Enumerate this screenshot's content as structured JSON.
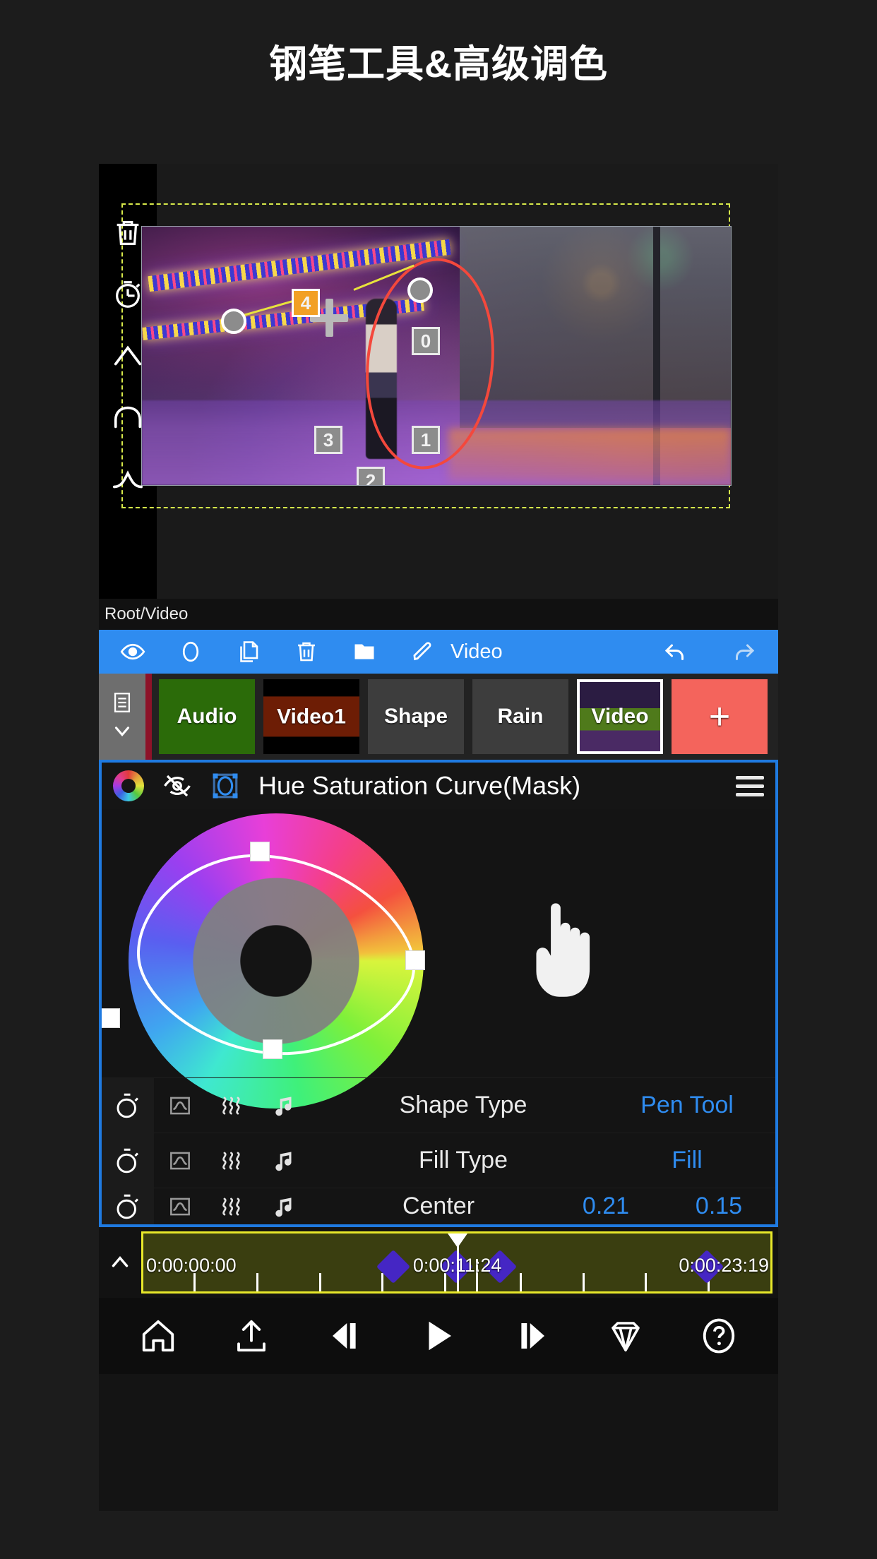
{
  "page": {
    "title": "钢笔工具&高级调色"
  },
  "preview": {
    "path_label": "Root/Video",
    "left_tools": [
      {
        "name": "delete-tool",
        "icon": "trash-icon"
      },
      {
        "name": "timer-tool",
        "icon": "stopwatch-icon"
      },
      {
        "name": "corner-point-tool",
        "icon": "corner-point-icon"
      },
      {
        "name": "smooth-point-tool",
        "icon": "smooth-curve-icon"
      },
      {
        "name": "bezier-point-tool",
        "icon": "bezier-anchor-icon"
      }
    ],
    "anchors": [
      {
        "label": "0"
      },
      {
        "label": "1"
      },
      {
        "label": "2"
      },
      {
        "label": "3"
      },
      {
        "label": "4",
        "selected": true
      }
    ]
  },
  "toolbar": {
    "items": [
      {
        "name": "visibility-button",
        "icon": "eye-icon"
      },
      {
        "name": "mask-button",
        "icon": "circle-outline-icon"
      },
      {
        "name": "duplicate-button",
        "icon": "copy-icon"
      },
      {
        "name": "delete-button",
        "icon": "trash-icon"
      },
      {
        "name": "folder-button",
        "icon": "folder-icon"
      },
      {
        "name": "rename-button",
        "icon": "pencil-icon"
      }
    ],
    "edit_label": "Video",
    "undo": {
      "name": "undo-button",
      "icon": "undo-icon"
    },
    "redo": {
      "name": "redo-button",
      "icon": "redo-icon"
    }
  },
  "layers": {
    "menu_icon": "list-icon",
    "expand_icon": "chevron-down-icon",
    "items": [
      {
        "label": "Audio",
        "type": "audio",
        "selected": false
      },
      {
        "label": "Video1",
        "type": "video",
        "selected": false
      },
      {
        "label": "Shape",
        "type": "shape",
        "selected": false
      },
      {
        "label": "Rain",
        "type": "effect",
        "selected": false
      },
      {
        "label": "Video",
        "type": "video",
        "selected": true
      }
    ],
    "add_label": "+"
  },
  "effect": {
    "title": "Hue Saturation Curve(Mask)",
    "icons": {
      "color_wheel": "color-wheel-icon",
      "visibility_off": "eye-off-icon",
      "mask": "mask-bounds-icon",
      "menu": "hamburger-menu-icon"
    },
    "rows": [
      {
        "name": "Shape Type",
        "value": "Pen Tool",
        "value2": "",
        "icons": [
          "stopwatch-icon",
          "curve-graph-icon",
          "wave-icon",
          "music-note-icon"
        ]
      },
      {
        "name": "Fill Type",
        "value": "Fill",
        "value2": "",
        "icons": [
          "stopwatch-icon",
          "curve-graph-icon",
          "wave-icon",
          "music-note-icon"
        ]
      },
      {
        "name": "Center",
        "value": "0.21",
        "value2": "0.15",
        "icons": [
          "stopwatch-icon",
          "curve-graph-icon",
          "wave-icon",
          "music-note-icon"
        ]
      }
    ]
  },
  "timeline": {
    "collapse_icon": "chevron-up-icon",
    "start_time": "0:00:00:00",
    "current_time": "0:00:11:24",
    "end_time": "0:00:23:19",
    "keyframe_count": 3
  },
  "bottom_nav": [
    {
      "name": "home-button",
      "icon": "home-icon"
    },
    {
      "name": "export-button",
      "icon": "upload-icon"
    },
    {
      "name": "prev-frame-button",
      "icon": "step-backward-icon"
    },
    {
      "name": "play-button",
      "icon": "play-icon"
    },
    {
      "name": "next-frame-button",
      "icon": "step-forward-icon"
    },
    {
      "name": "pro-button",
      "icon": "diamond-icon"
    },
    {
      "name": "help-button",
      "icon": "question-circle-icon"
    }
  ],
  "colors": {
    "accent_blue": "#2f8cf0",
    "panel_border": "#1f7ae0",
    "timeline_yellow": "#e8e82a",
    "keyframe_purple": "#4526c4",
    "mask_red": "#f4483c",
    "selected_anchor": "#f2a024",
    "add_layer_red": "#f4645c",
    "audio_green": "#2b6b09",
    "video1_brown": "#6d1d05"
  }
}
